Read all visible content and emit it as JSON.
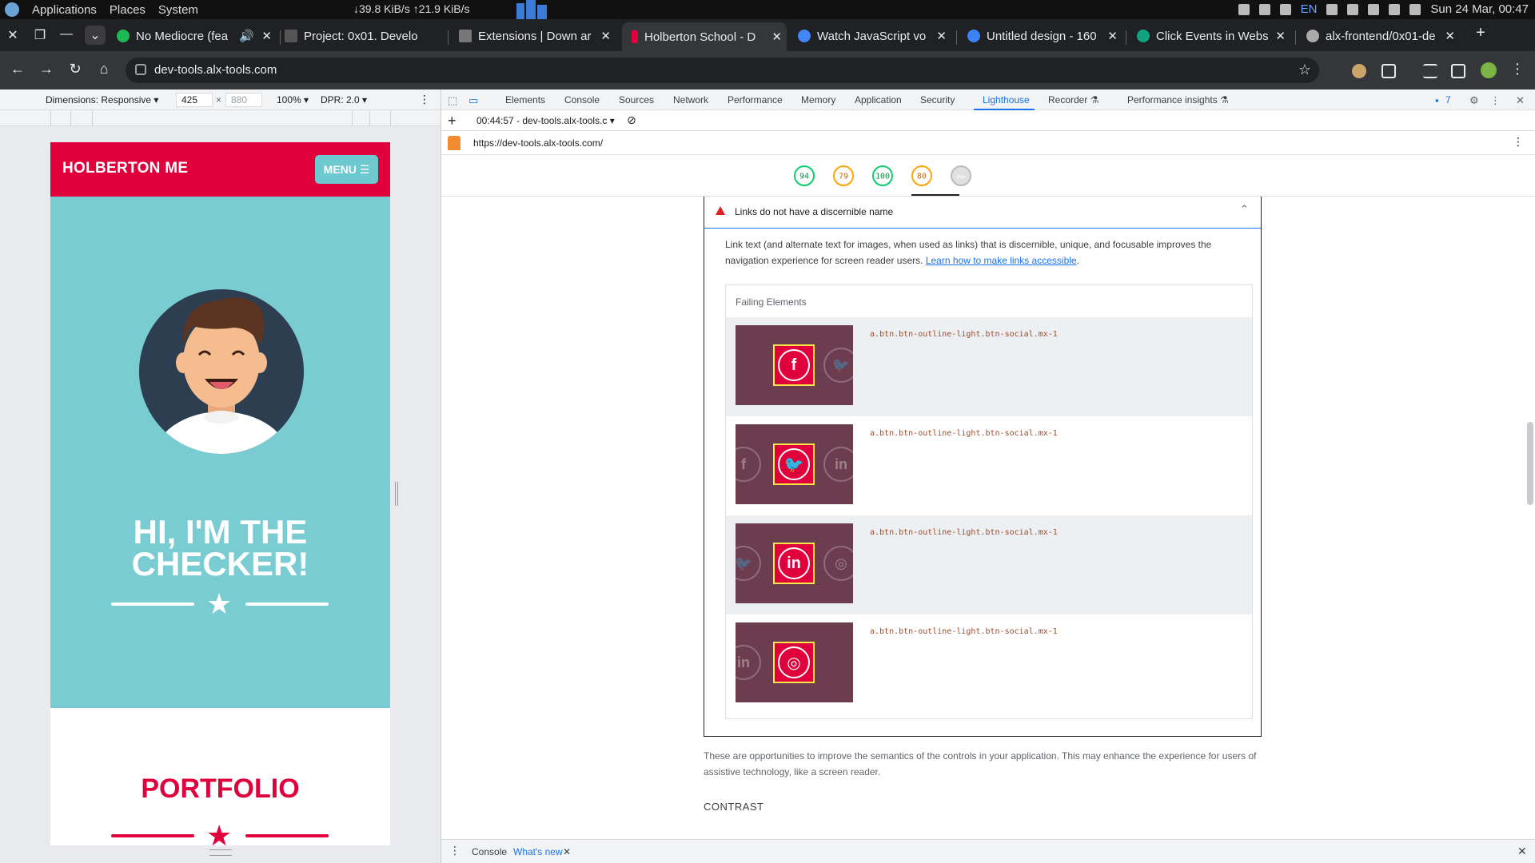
{
  "os": {
    "menu": [
      "Applications",
      "Places",
      "System"
    ],
    "net": "↓39.8 KiB/s ↑21.9 KiB/s",
    "lang": "EN",
    "clock": "Sun 24 Mar, 00:47"
  },
  "tabs": [
    {
      "title": "No Mediocre (fea",
      "icon": "spotify-icon",
      "color": "#1db954"
    },
    {
      "title": "Project: 0x01. Develo",
      "icon": "alx-icon",
      "color": "#444"
    },
    {
      "title": "Extensions | Down ar",
      "icon": "book-icon",
      "color": "#777"
    },
    {
      "title": "Holberton School - D",
      "icon": "holberton-icon",
      "color": "#e0003c"
    },
    {
      "title": "Watch JavaScript vo",
      "icon": "chrome-icon",
      "color": "#4285f4"
    },
    {
      "title": "Untitled design - 160",
      "icon": "canva-icon",
      "color": "#3b82f6"
    },
    {
      "title": "Click Events in Webs",
      "icon": "chatgpt-icon",
      "color": "#10a37f"
    },
    {
      "title": "alx-frontend/0x01-de",
      "icon": "github-icon",
      "color": "#aaa"
    }
  ],
  "omnibox": {
    "url": "dev-tools.alx-tools.com"
  },
  "device_toolbar": {
    "dimensions": "Dimensions: Responsive ▾",
    "width": "425",
    "times": "×",
    "height": "880",
    "zoom": "100% ▾",
    "dpr": "DPR: 2.0 ▾"
  },
  "site": {
    "brand": "HOLBERTON ME",
    "menu": "MENU ☰",
    "hero_title_1": "HI, I'M THE",
    "hero_title_2": "CHECKER!",
    "portfolio": "PORTFOLIO",
    "colors": {
      "red": "#e0003c",
      "teal": "#78ccd2"
    }
  },
  "devtools": {
    "tabs": [
      "Elements",
      "Console",
      "Sources",
      "Network",
      "Performance",
      "Memory",
      "Application",
      "Security",
      "Lighthouse",
      "Recorder ⚗",
      "Performance insights ⚗"
    ],
    "active_tab": "Lighthouse",
    "issues_count": "7",
    "report_time": "00:44:57 - dev-tools.alx-tools.c ▾",
    "report_url": "https://dev-tools.alx-tools.com/",
    "scores": [
      {
        "value": "94",
        "color": "#0cce6b"
      },
      {
        "value": "79",
        "color": "#ffa400"
      },
      {
        "value": "100",
        "color": "#0cce6b"
      },
      {
        "value": "80",
        "color": "#ffa400"
      },
      {
        "value": "PWA",
        "color": "#bbbbbb"
      }
    ],
    "audit": {
      "title": "Links do not have a discernible name",
      "desc_1": "Link text (and alternate text for images, when used as links) that is discernible, unique, and focusable improves the",
      "desc_2": "navigation experience for screen reader users.",
      "learn_link": "Learn how to make links accessible",
      "desc_end": ".",
      "failing_header": "Failing Elements",
      "rows": [
        {
          "selector": "a.btn.btn-outline-light.btn-social.mx-1",
          "icon": "facebook-icon",
          "glyph": "f",
          "prev": "",
          "next": "🐦"
        },
        {
          "selector": "a.btn.btn-outline-light.btn-social.mx-1",
          "icon": "twitter-icon",
          "glyph": "🐦",
          "prev": "f",
          "next": "in"
        },
        {
          "selector": "a.btn.btn-outline-light.btn-social.mx-1",
          "icon": "linkedin-icon",
          "glyph": "in",
          "prev": "🐦",
          "next": "◎"
        },
        {
          "selector": "a.btn.btn-outline-light.btn-social.mx-1",
          "icon": "dribbble-icon",
          "glyph": "◎",
          "prev": "in",
          "next": ""
        }
      ]
    },
    "footnote": "These are opportunities to improve the semantics of the controls in your application. This may enhance the experience for users of assistive technology, like a screen reader.",
    "contrast": "CONTRAST",
    "drawer": {
      "console": "Console",
      "whats_new": "What's new"
    }
  }
}
